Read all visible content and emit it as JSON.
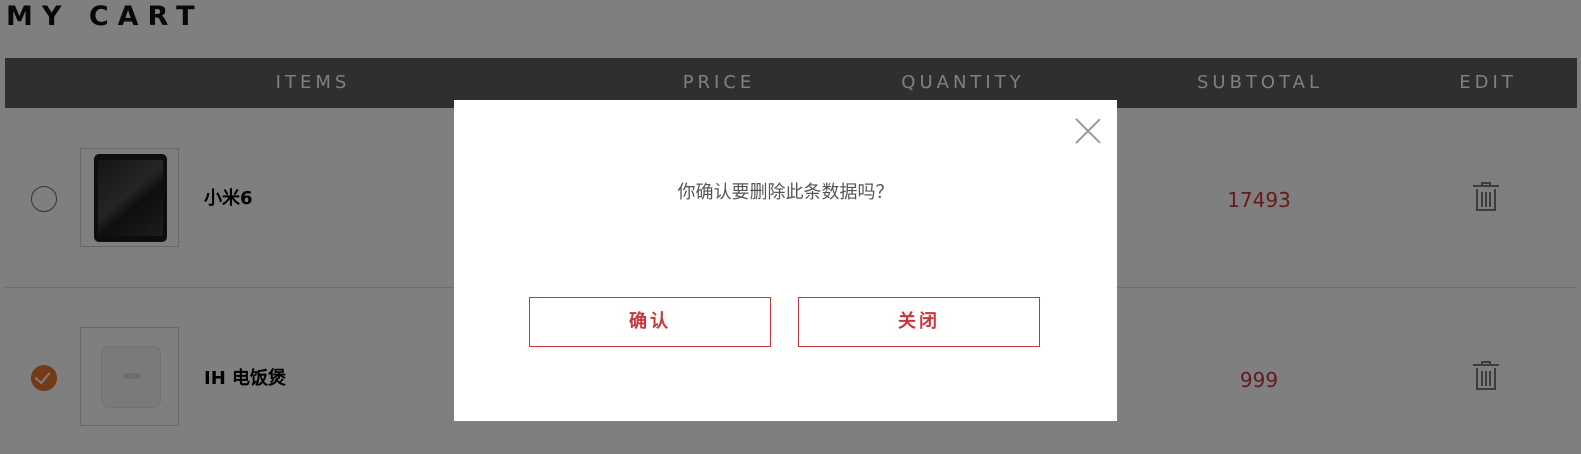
{
  "header": {
    "title": "MY CART"
  },
  "table": {
    "columns": [
      "ITEMS",
      "PRICE",
      "QUANTITY",
      "SUBTOTAL",
      "EDIT"
    ]
  },
  "rows": [
    {
      "name": "小米6",
      "subtotal": "17493",
      "selected": false,
      "image_icon": "phone-image"
    },
    {
      "name": "IH 电饭煲",
      "subtotal": "999",
      "selected": true,
      "image_icon": "rice-cooker-image"
    }
  ],
  "dialog": {
    "message": "你确认要删除此条数据吗？",
    "confirm_label": "确认",
    "close_label": "关闭",
    "close_icon": "close-icon"
  },
  "colors": {
    "accent": "#c8363b",
    "checked": "#e8772e",
    "header_bg": "#605e5f"
  }
}
